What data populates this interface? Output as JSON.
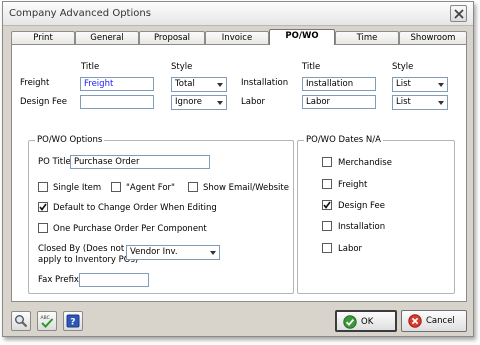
{
  "window": {
    "title": "Company Advanced Options"
  },
  "tabs": [
    "Print",
    "General",
    "Proposal",
    "Invoice",
    "PO/WO",
    "Time",
    "Showroom"
  ],
  "active_tab": "PO/WO",
  "top": {
    "title_header": "Title",
    "style_header": "Style",
    "freight": {
      "label": "Freight",
      "title": "Freight",
      "style": "Total"
    },
    "design_fee": {
      "label": "Design Fee",
      "title": "",
      "style": "Ignore"
    },
    "installation": {
      "label": "Installation",
      "title": "Installation",
      "style": "List"
    },
    "labor": {
      "label": "Labor",
      "title": "Labor",
      "style": "List"
    }
  },
  "po_wo_options": {
    "legend": "PO/WO Options",
    "po_title_label": "PO Title",
    "po_title_value": "Purchase Order",
    "single_item": {
      "label": "Single Item",
      "checked": false
    },
    "agent_for": {
      "label": "\"Agent For\"",
      "checked": false
    },
    "show_email": {
      "label": "Show Email/Website",
      "checked": false
    },
    "default_change_order": {
      "label": "Default to Change Order When Editing",
      "checked": true
    },
    "one_po_per_component": {
      "label": "One Purchase Order Per Component",
      "checked": false
    },
    "closed_by_label_line1": "Closed By (Does not",
    "closed_by_label_line2": "apply to Inventory POs)",
    "closed_by_value": "Vendor Inv.",
    "fax_prefix_label": "Fax Prefix",
    "fax_prefix_value": ""
  },
  "dates_na": {
    "legend": "PO/WO Dates N/A",
    "items": [
      {
        "label": "Merchandise",
        "checked": false
      },
      {
        "label": "Freight",
        "checked": false
      },
      {
        "label": "Design Fee",
        "checked": true
      },
      {
        "label": "Installation",
        "checked": false
      },
      {
        "label": "Labor",
        "checked": false
      }
    ]
  },
  "buttons": {
    "ok": "OK",
    "cancel": "Cancel"
  },
  "icons": [
    "search-icon",
    "spellcheck-icon",
    "help-icon",
    "check-icon",
    "cancel-icon"
  ]
}
